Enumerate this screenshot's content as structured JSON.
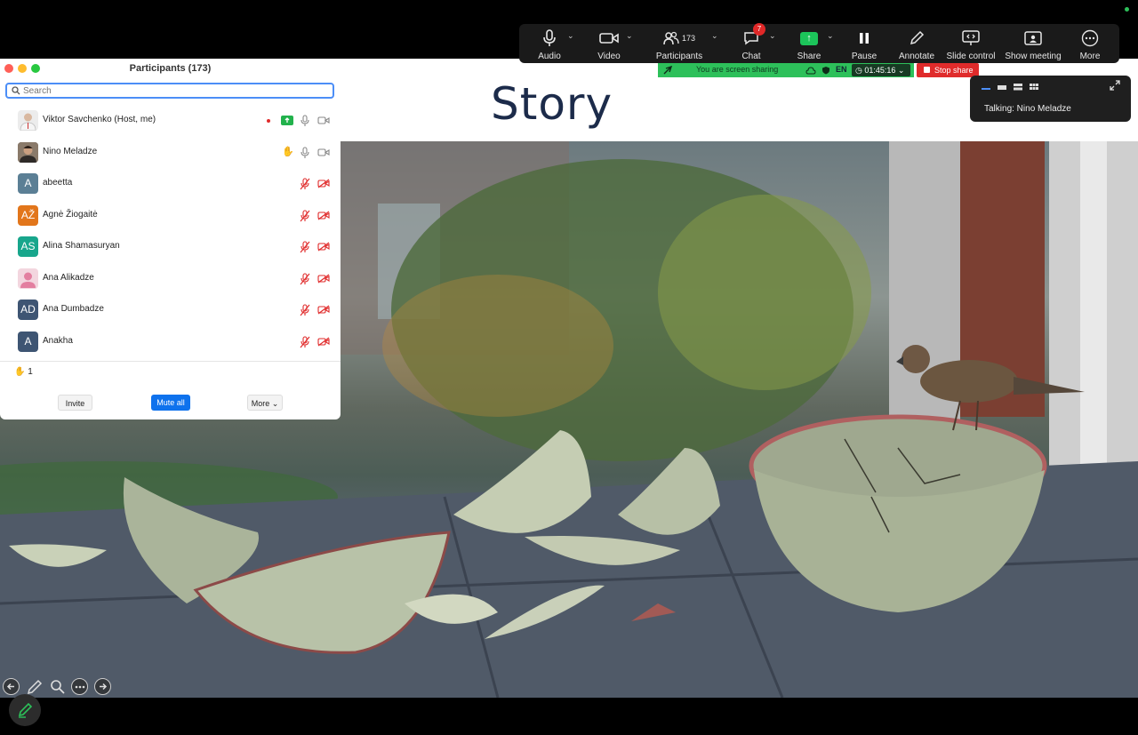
{
  "toolbar": {
    "audio_label": "Audio",
    "video_label": "Video",
    "participants_label": "Participants",
    "participants_count": "173",
    "chat_label": "Chat",
    "chat_badge": "7",
    "share_label": "Share",
    "pause_label": "Pause",
    "annotate_label": "Annotate",
    "slide_control_label": "Slide control",
    "show_meeting_label": "Show meeting",
    "more_label": "More"
  },
  "sharing_bar": {
    "status_text": "You are screen sharing",
    "language": "EN",
    "timer": "01:45:16",
    "stop_share_label": "Stop share"
  },
  "talking": {
    "text": "Talking: Nino Meladze"
  },
  "slide": {
    "title": "Story"
  },
  "panel": {
    "title": "Participants (173)",
    "search_placeholder": "Search",
    "participants": [
      {
        "name": "Viktor Savchenko (Host, me)",
        "initials": "",
        "color": "#e8e8e8"
      },
      {
        "name": "Nino Meladze",
        "initials": "",
        "color": "#6a5a4a"
      },
      {
        "name": "abeetta",
        "initials": "A",
        "color": "#5b7f95"
      },
      {
        "name": "Agnė Žiogaitė",
        "initials": "AŽ",
        "color": "#e2761b"
      },
      {
        "name": "Alina Shamasuryan",
        "initials": "AS",
        "color": "#18a68c"
      },
      {
        "name": "Ana Alikadze",
        "initials": "",
        "color": "#f3d6df"
      },
      {
        "name": "Ana Dumbadze",
        "initials": "AD",
        "color": "#3e5573"
      },
      {
        "name": "Anakha",
        "initials": "A",
        "color": "#3e5573"
      }
    ],
    "raised_hands": "1",
    "invite_label": "Invite",
    "mute_all_label": "Mute all",
    "more_label": "More"
  }
}
